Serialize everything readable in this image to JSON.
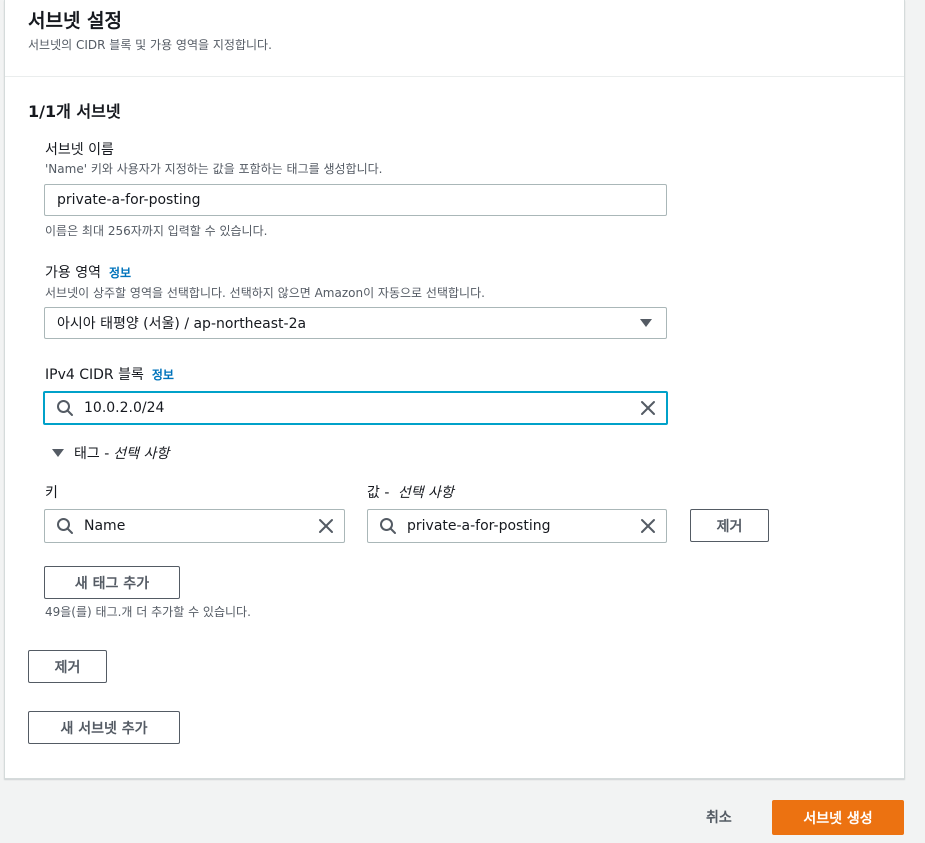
{
  "section": {
    "title": "서브넷 설정",
    "description": "서브넷의 CIDR 블록 및 가용 영역을 지정합니다.",
    "subnet_count": "1/1개 서브넷"
  },
  "subnet_name": {
    "label": "서브넷 이름",
    "description": "'Name' 키와 사용자가 지정하는 값을 포함하는 태그를 생성합니다.",
    "value": "private-a-for-posting",
    "hint": "이름은 최대 256자까지 입력할 수 있습니다."
  },
  "availability_zone": {
    "label": "가용 영역",
    "info": "정보",
    "description": "서브넷이 상주할 영역을 선택합니다. 선택하지 않으면 Amazon이 자동으로 선택합니다.",
    "selected": "아시아 태평양 (서울) / ap-northeast-2a"
  },
  "ipv4_cidr": {
    "label": "IPv4 CIDR 블록",
    "info": "정보",
    "value": "10.0.2.0/24"
  },
  "tags": {
    "toggle_label": "태그 - ",
    "toggle_optional": "선택 사항",
    "key_label": "키",
    "value_label_prefix": "값 - ",
    "value_label_optional": "선택 사항",
    "rows": [
      {
        "key": "Name",
        "value": "private-a-for-posting",
        "remove_label": "제거"
      }
    ],
    "add_tag_label": "새 태그 추가",
    "hint": "49을(를) 태그.개 더 추가할 수 있습니다."
  },
  "subnet_actions": {
    "remove_label": "제거",
    "add_subnet_label": "새 서브넷 추가"
  },
  "footer": {
    "cancel_label": "취소",
    "create_label": "서브넷 생성"
  },
  "colors": {
    "primary": "#ec7211",
    "focus": "#00a1c9",
    "link": "#0073bb"
  }
}
